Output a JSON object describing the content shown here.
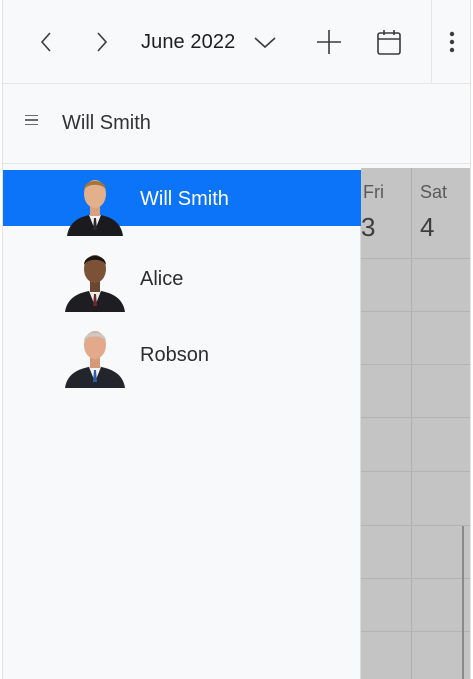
{
  "toolbar": {
    "date_label": "June 2022",
    "prev_icon": "chevron-left-icon",
    "next_icon": "chevron-right-icon",
    "date_picker_icon": "chevron-down-icon",
    "add_icon": "plus-icon",
    "today_icon": "calendar-icon",
    "more_icon": "more-vertical-icon"
  },
  "resource_header": {
    "menu_icon": "hamburger-icon",
    "title": "Will Smith"
  },
  "calendar": {
    "days": [
      {
        "name": "Fri",
        "number": "3"
      },
      {
        "name": "Sat",
        "number": "4"
      }
    ],
    "overlay_color": "#c4c4c4"
  },
  "resources": {
    "selected_color": "#0b74f8",
    "items": [
      {
        "label": "Will Smith",
        "selected": true
      },
      {
        "label": "Alice",
        "selected": false
      },
      {
        "label": "Robson",
        "selected": false
      }
    ]
  }
}
